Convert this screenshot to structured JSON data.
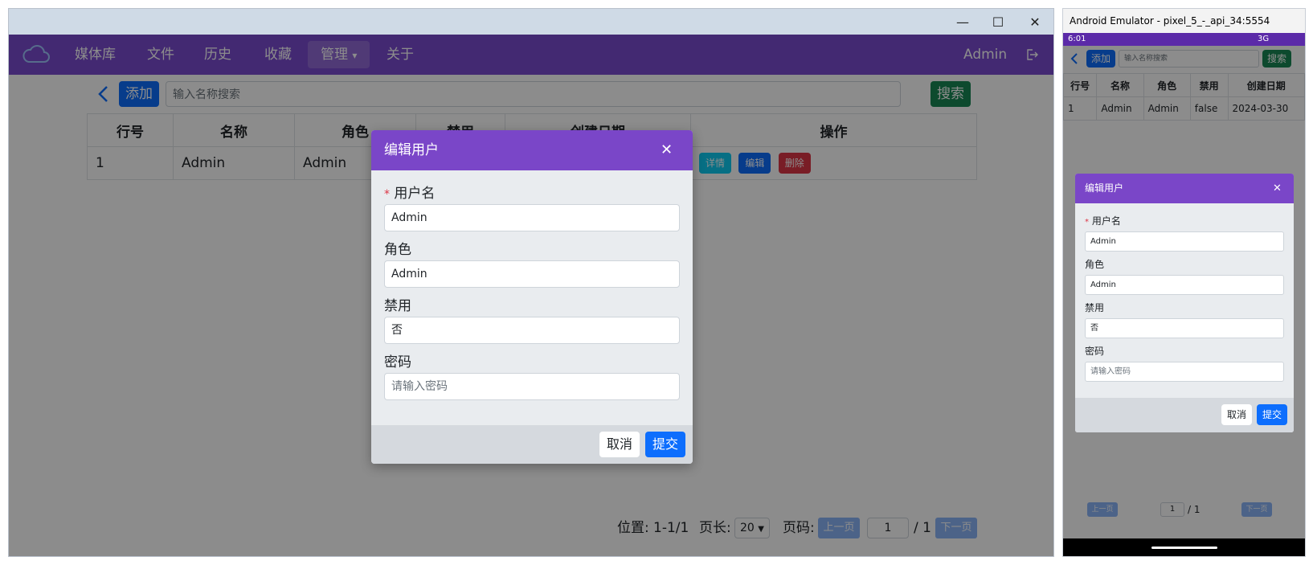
{
  "window": {
    "controls": {
      "minimize": "—",
      "maximize": "☐",
      "close": "✕"
    }
  },
  "nav": {
    "logo_icon": "cloud-icon",
    "items": [
      "媒体库",
      "文件",
      "历史",
      "收藏",
      "管理",
      "关于"
    ],
    "active_index": 4,
    "dropdown_caret": "▾",
    "user": "Admin",
    "logout_icon": "logout-icon"
  },
  "toolbar": {
    "back_icon": "chevron-left-icon",
    "add_label": "添加",
    "search_placeholder": "输入名称搜索",
    "search_label": "搜索"
  },
  "table": {
    "headers": [
      "行号",
      "名称",
      "角色",
      "禁用",
      "创建日期",
      "操作"
    ],
    "rows": [
      {
        "index": "1",
        "name": "Admin",
        "role": "Admin",
        "disabled": "false",
        "created": "2024-03-30"
      }
    ],
    "actions": {
      "detail": "详情",
      "edit": "编辑",
      "delete": "删除"
    }
  },
  "pagination": {
    "position_label": "位置:",
    "position_value": "1-1/1",
    "pagesize_label": "页长:",
    "pagesize_value": "20",
    "page_label": "页码:",
    "prev": "上一页",
    "page_value": "1",
    "total": "/ 1",
    "next": "下一页"
  },
  "modal": {
    "title": "编辑用户",
    "close_icon": "close-icon",
    "required_mark": "*",
    "fields": [
      {
        "label": "用户名",
        "value": "Admin",
        "placeholder": ""
      },
      {
        "label": "角色",
        "value": "Admin",
        "placeholder": ""
      },
      {
        "label": "禁用",
        "value": "否",
        "placeholder": ""
      },
      {
        "label": "密码",
        "value": "",
        "placeholder": "请输入密码"
      }
    ],
    "cancel": "取消",
    "submit": "提交"
  },
  "emulator": {
    "title": "Android Emulator - pixel_5_-_api_34:5554",
    "status_time": "6:01",
    "status_network": "3G"
  },
  "colors": {
    "nav_bg": "#7a4bd0",
    "modal_header": "#7a46c8",
    "add_button": "#0d6efd",
    "search_button": "#198754",
    "detail_button": "#0dcaf0",
    "delete_button": "#dc3545",
    "submit_button": "#0d6efd"
  }
}
